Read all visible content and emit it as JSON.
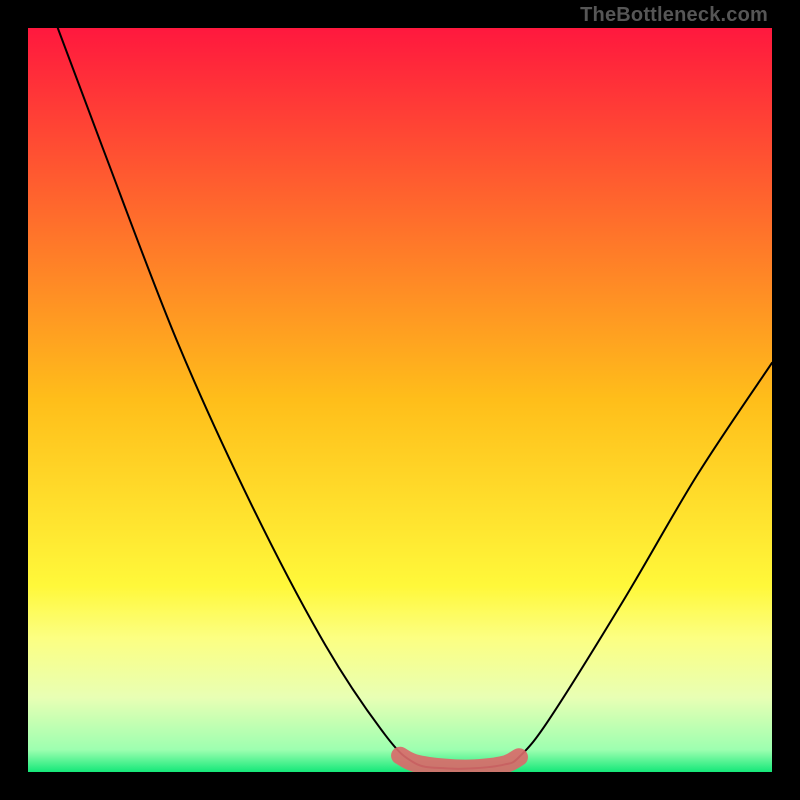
{
  "watermark": "TheBottleneck.com",
  "chart_data": {
    "type": "line",
    "title": "",
    "xlabel": "",
    "ylabel": "",
    "xlim": [
      0,
      100
    ],
    "ylim": [
      0,
      100
    ],
    "background_gradient": {
      "stops": [
        {
          "offset": 0.0,
          "color": "#ff183e"
        },
        {
          "offset": 0.5,
          "color": "#ffbe1a"
        },
        {
          "offset": 0.75,
          "color": "#fff83a"
        },
        {
          "offset": 0.82,
          "color": "#fcff82"
        },
        {
          "offset": 0.9,
          "color": "#e8ffb4"
        },
        {
          "offset": 0.97,
          "color": "#9dffb0"
        },
        {
          "offset": 1.0,
          "color": "#15e879"
        }
      ]
    },
    "curve": {
      "color": "#000000",
      "width": 2,
      "points": [
        {
          "x": 4,
          "y": 100
        },
        {
          "x": 10,
          "y": 84
        },
        {
          "x": 20,
          "y": 58
        },
        {
          "x": 30,
          "y": 36
        },
        {
          "x": 40,
          "y": 17
        },
        {
          "x": 48,
          "y": 5
        },
        {
          "x": 52,
          "y": 1.2
        },
        {
          "x": 56,
          "y": 0.5
        },
        {
          "x": 60,
          "y": 0.5
        },
        {
          "x": 64,
          "y": 1.0
        },
        {
          "x": 66,
          "y": 2.0
        },
        {
          "x": 70,
          "y": 7
        },
        {
          "x": 80,
          "y": 23
        },
        {
          "x": 90,
          "y": 40
        },
        {
          "x": 100,
          "y": 55
        }
      ]
    },
    "lowlight_band": {
      "color": "#d96a6a",
      "thickness": 2.4,
      "points": [
        {
          "x": 50,
          "y": 2.2
        },
        {
          "x": 52,
          "y": 1.2
        },
        {
          "x": 56,
          "y": 0.6
        },
        {
          "x": 60,
          "y": 0.5
        },
        {
          "x": 64,
          "y": 1.0
        },
        {
          "x": 66,
          "y": 2.0
        }
      ]
    }
  }
}
